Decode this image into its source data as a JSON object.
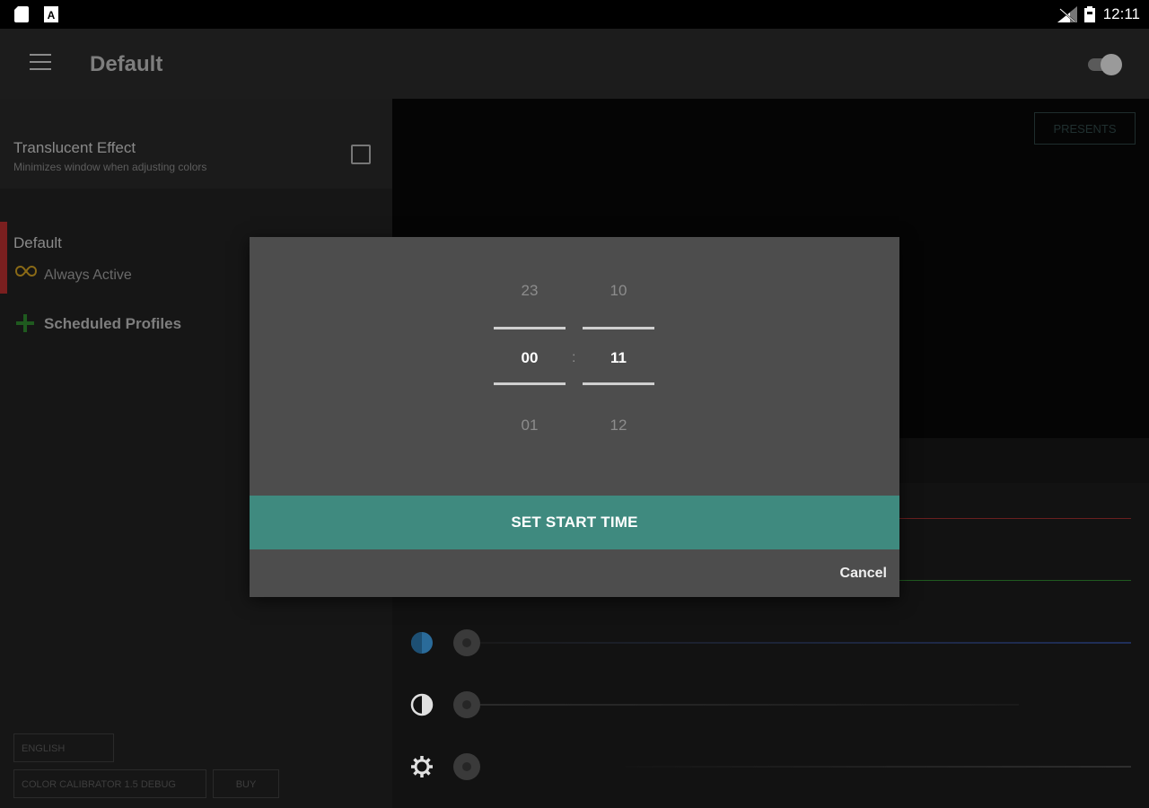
{
  "status_bar": {
    "time": "12:11",
    "left_icons": [
      "sd-card-icon",
      "autofill-icon"
    ],
    "right_icons": [
      "no-signal-icon",
      "battery-icon"
    ]
  },
  "app_bar": {
    "title": "Default",
    "master_toggle": "off"
  },
  "left_panel": {
    "translucent": {
      "title": "Translucent Effect",
      "subtitle": "Minimizes window when adjusting colors",
      "checked": false
    },
    "profile": {
      "name": "Default",
      "status": "Always Active"
    },
    "scheduled_label": "Scheduled Profiles",
    "language_button": "ENGLISH",
    "version_button": "COLOR CALIBRATOR 1.5 DEBUG",
    "buy_button": "BUY"
  },
  "right_panel": {
    "presents_button": "PRESENTS",
    "sliders": [
      {
        "icon": "saturation-icon",
        "color": "#2a6b9a"
      },
      {
        "icon": "contrast-icon",
        "color": "#e0e0e0"
      },
      {
        "icon": "brightness-gear-icon",
        "color": "#e0e0e0"
      }
    ],
    "colors": {
      "red": "#6a1f1f",
      "green": "#1f5a1f",
      "blue": "#1f2f5a"
    }
  },
  "dialog": {
    "hours": {
      "above": "23",
      "selected": "00",
      "below": "01"
    },
    "minutes": {
      "above": "10",
      "selected": "11",
      "below": "12"
    },
    "separator": ":",
    "set_button": "SET START TIME",
    "cancel_button": "Cancel",
    "accent_color": "#3f8a7f"
  }
}
